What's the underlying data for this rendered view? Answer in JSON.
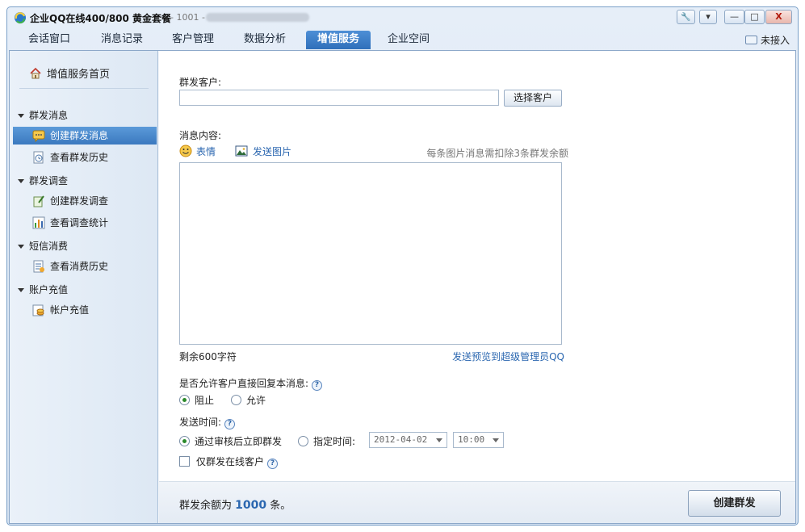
{
  "window": {
    "title": "企业QQ在线400/800 黄金套餐",
    "subtitle": "- 1001 -",
    "controls": {
      "tools": "🔧",
      "menu": "▾",
      "minimize": "—",
      "maximize": "□",
      "close": "X"
    }
  },
  "tabs": [
    {
      "label": "会话窗口"
    },
    {
      "label": "消息记录"
    },
    {
      "label": "客户管理"
    },
    {
      "label": "数据分析"
    },
    {
      "label": "增值服务",
      "active": true
    },
    {
      "label": "企业空间"
    }
  ],
  "status": {
    "label": "未接入"
  },
  "sidebar": {
    "home": "增值服务首页",
    "groups": [
      {
        "label": "群发消息",
        "items": [
          {
            "label": "创建群发消息",
            "active": true
          },
          {
            "label": "查看群发历史"
          }
        ]
      },
      {
        "label": "群发调查",
        "items": [
          {
            "label": "创建群发调查"
          },
          {
            "label": "查看调查统计"
          }
        ]
      },
      {
        "label": "短信消费",
        "items": [
          {
            "label": "查看消费历史"
          }
        ]
      },
      {
        "label": "账户充值",
        "items": [
          {
            "label": "帐户充值"
          }
        ]
      }
    ]
  },
  "form": {
    "recipients_label": "群发客户:",
    "recipients_value": "",
    "choose_button": "选择客户",
    "content_label": "消息内容:",
    "emoji_label": "表情",
    "image_label": "发送图片",
    "image_note": "每条图片消息需扣除3条群发余额",
    "content_value": "",
    "remaining": "剩余600字符",
    "preview_link": "发送预览到超级管理员QQ",
    "reply_label": "是否允许客户直接回复本消息:",
    "reply_options": [
      "阻止",
      "允许"
    ],
    "reply_selected": "阻止",
    "time_label": "发送时间:",
    "time_options": [
      "通过审核后立即群发",
      "指定时间:"
    ],
    "time_selected": "通过审核后立即群发",
    "date_value": "2012-04-02",
    "clock_value": "10:00",
    "online_only_label": "仅群发在线客户",
    "help_glyph": "?"
  },
  "footer": {
    "quota_prefix": "群发余额为",
    "quota_value": "1000",
    "quota_suffix": "条。",
    "create_button": "创建群发"
  },
  "colors": {
    "accent": "#2f6fba",
    "link": "#2b67b0",
    "active_item": "#3b79bf"
  }
}
